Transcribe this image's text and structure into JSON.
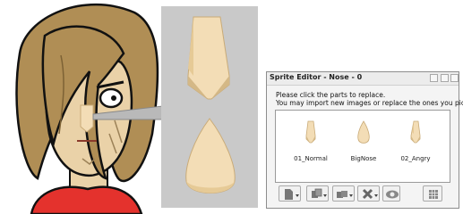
{
  "window": {
    "title": "Sprite Editor - Nose - 0",
    "instruction_line1": "Please click the parts to replace.",
    "instruction_line2": "You may import new images or replace the ones you picked."
  },
  "parts": [
    {
      "label": "01_Normal",
      "icon": "normal-nose-icon"
    },
    {
      "label": "BigNose",
      "icon": "big-nose-icon"
    },
    {
      "label": "02_Angry",
      "icon": "angry-nose-icon"
    }
  ],
  "toolbar": {
    "buttons": [
      "new-file-icon",
      "copy-icon",
      "duplicate-icon",
      "delete-icon",
      "preview-eye-icon",
      "grid-icon"
    ]
  },
  "colors": {
    "hair": "#b08e55",
    "skin": "#ead2a8",
    "nose_light": "#f3ddb6",
    "nose_shadow": "#d4b886",
    "shirt": "#e4322d",
    "panel": "#c9c9c9"
  }
}
